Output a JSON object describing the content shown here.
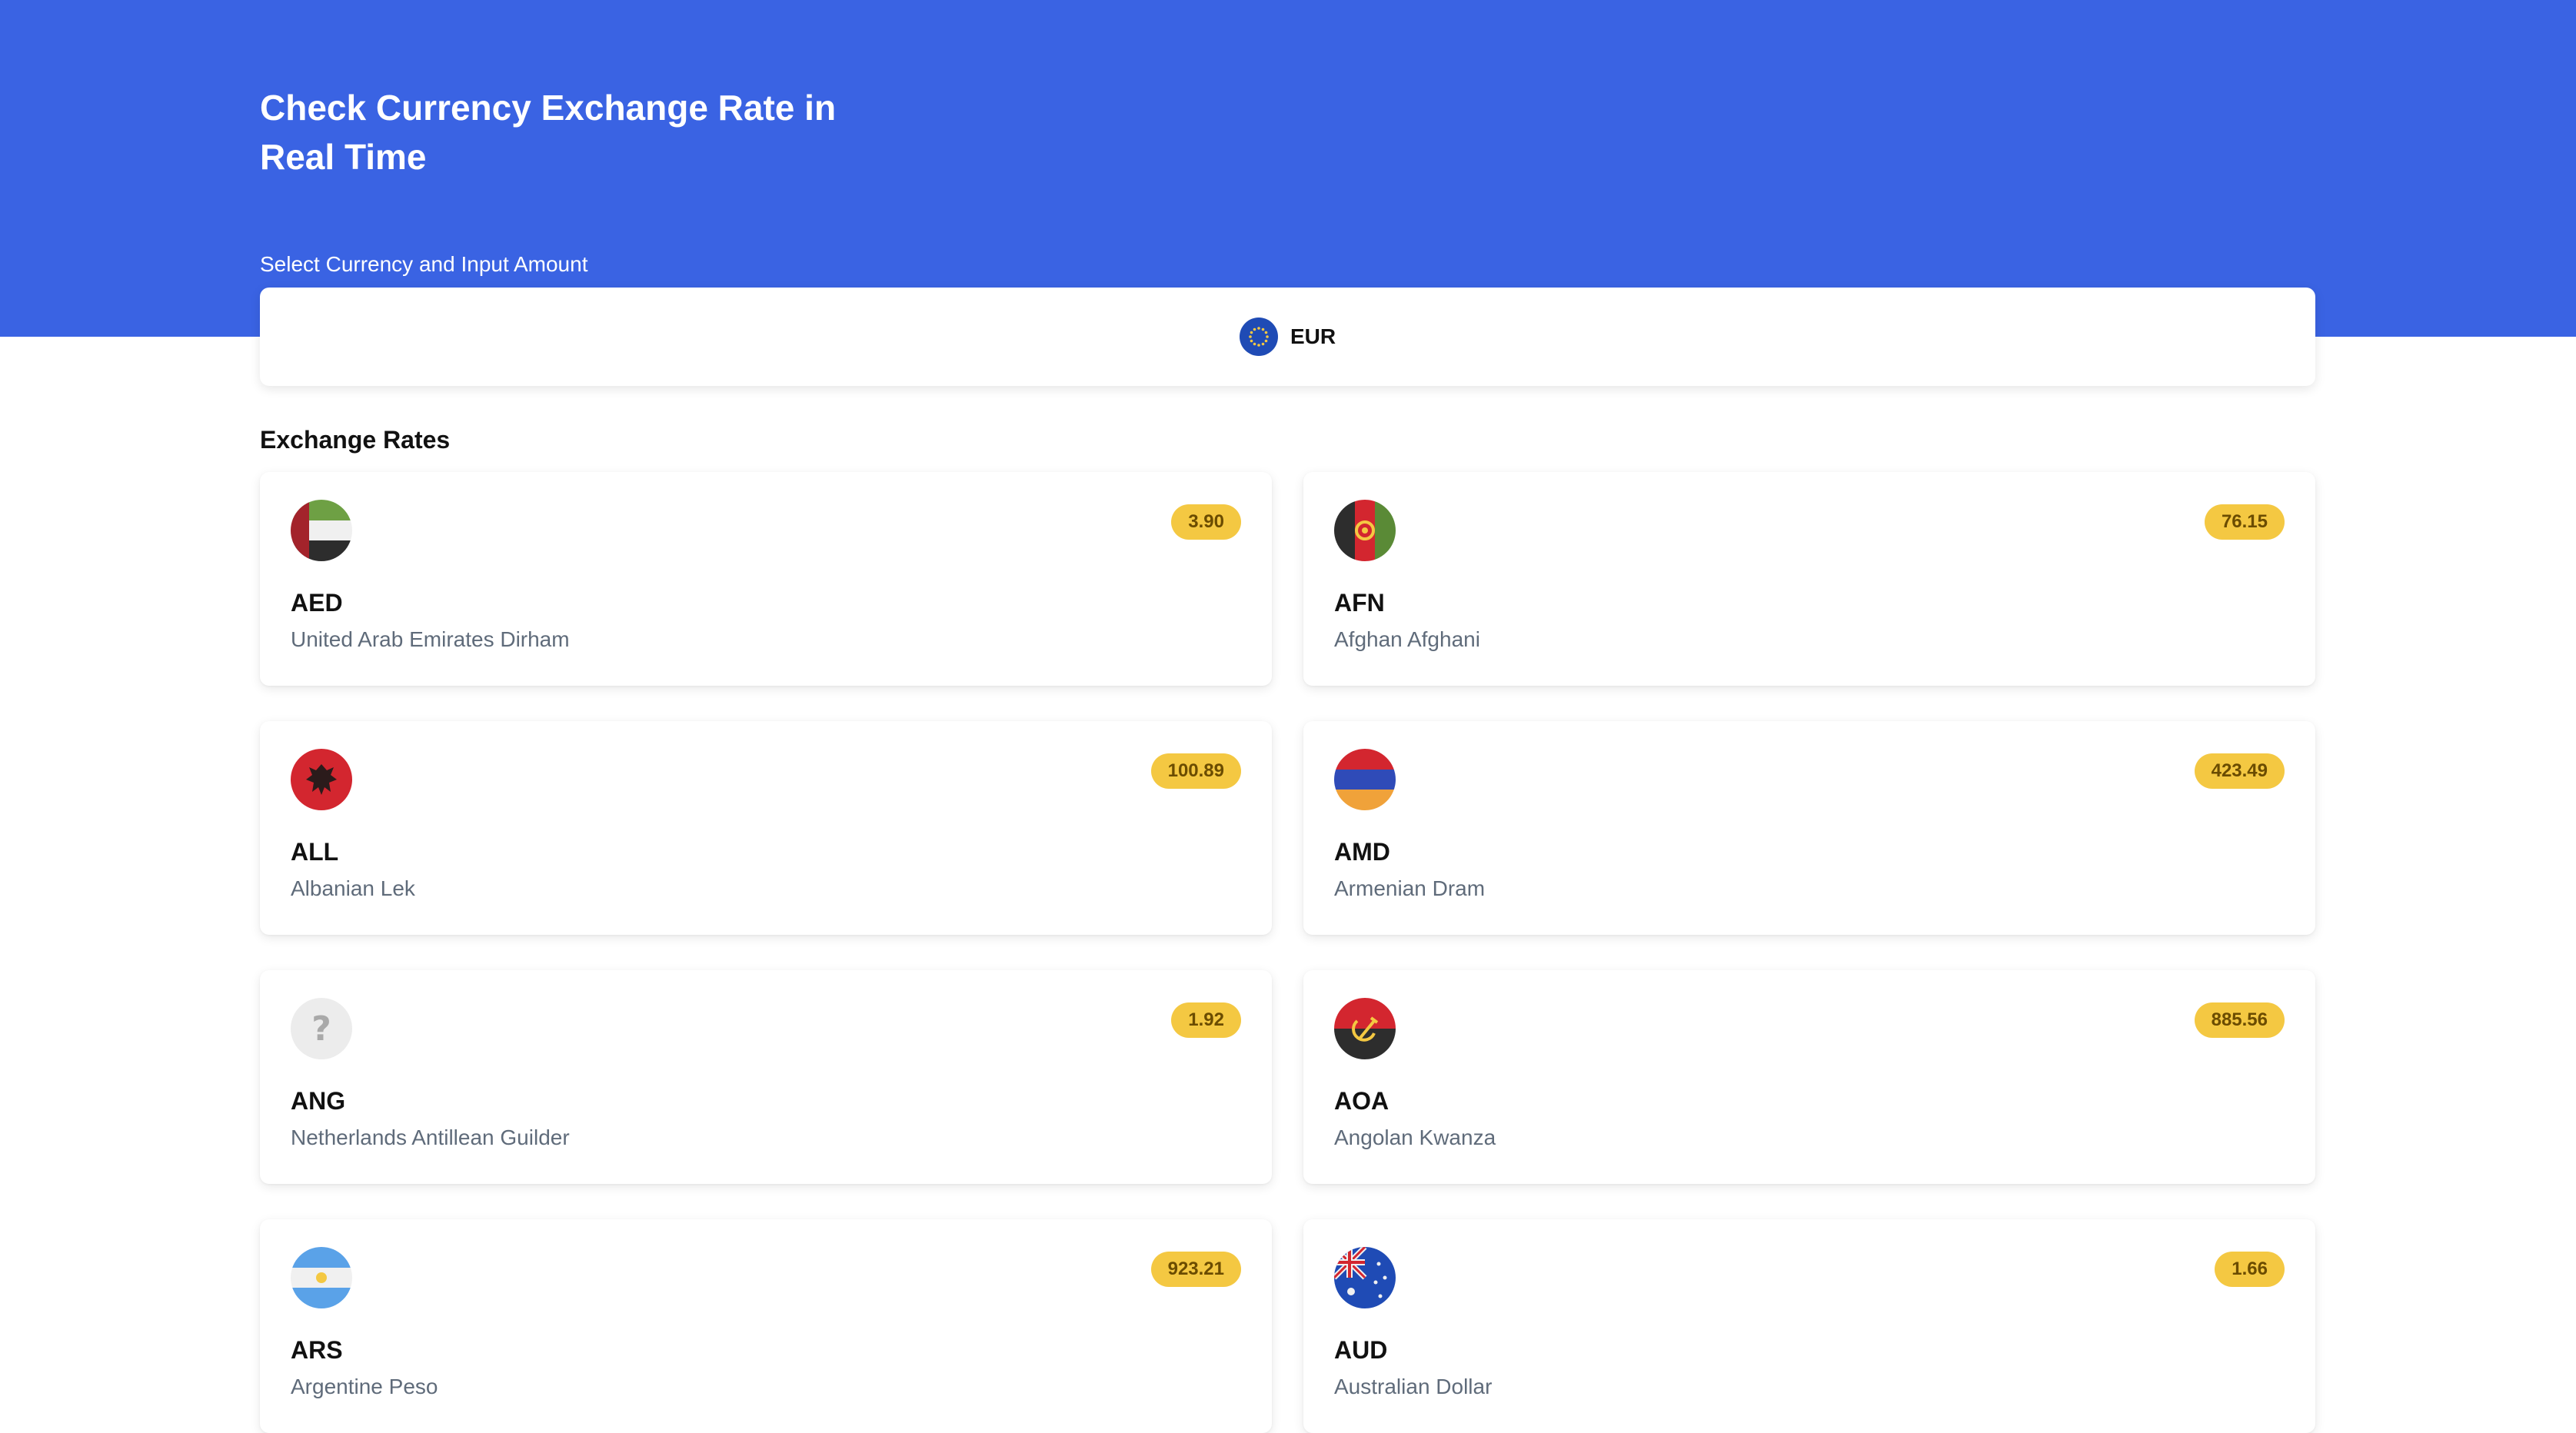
{
  "header": {
    "title_line1": "Check Currency Exchange Rate in",
    "title_line2": "Real Time",
    "select_label": "Select Currency and Input Amount",
    "bg_color": "#3a63e3"
  },
  "selector": {
    "currency_code": "EUR",
    "flag_icon": "eu-flag-icon"
  },
  "section": {
    "title": "Exchange Rates"
  },
  "rates": [
    {
      "code": "AED",
      "name": "United Arab Emirates Dirham",
      "rate": "3.90",
      "flag": "uae-flag-icon"
    },
    {
      "code": "AFN",
      "name": "Afghan Afghani",
      "rate": "76.15",
      "flag": "afghanistan-flag-icon"
    },
    {
      "code": "ALL",
      "name": "Albanian Lek",
      "rate": "100.89",
      "flag": "albania-flag-icon"
    },
    {
      "code": "AMD",
      "name": "Armenian Dram",
      "rate": "423.49",
      "flag": "armenia-flag-icon"
    },
    {
      "code": "ANG",
      "name": "Netherlands Antillean Guilder",
      "rate": "1.92",
      "flag": "unknown-flag-icon"
    },
    {
      "code": "AOA",
      "name": "Angolan Kwanza",
      "rate": "885.56",
      "flag": "angola-flag-icon"
    },
    {
      "code": "ARS",
      "name": "Argentine Peso",
      "rate": "923.21",
      "flag": "argentina-flag-icon"
    },
    {
      "code": "AUD",
      "name": "Australian Dollar",
      "rate": "1.66",
      "flag": "australia-flag-icon"
    }
  ],
  "colors": {
    "rate_badge": "#f4c842",
    "rate_text": "#6b4c00"
  }
}
